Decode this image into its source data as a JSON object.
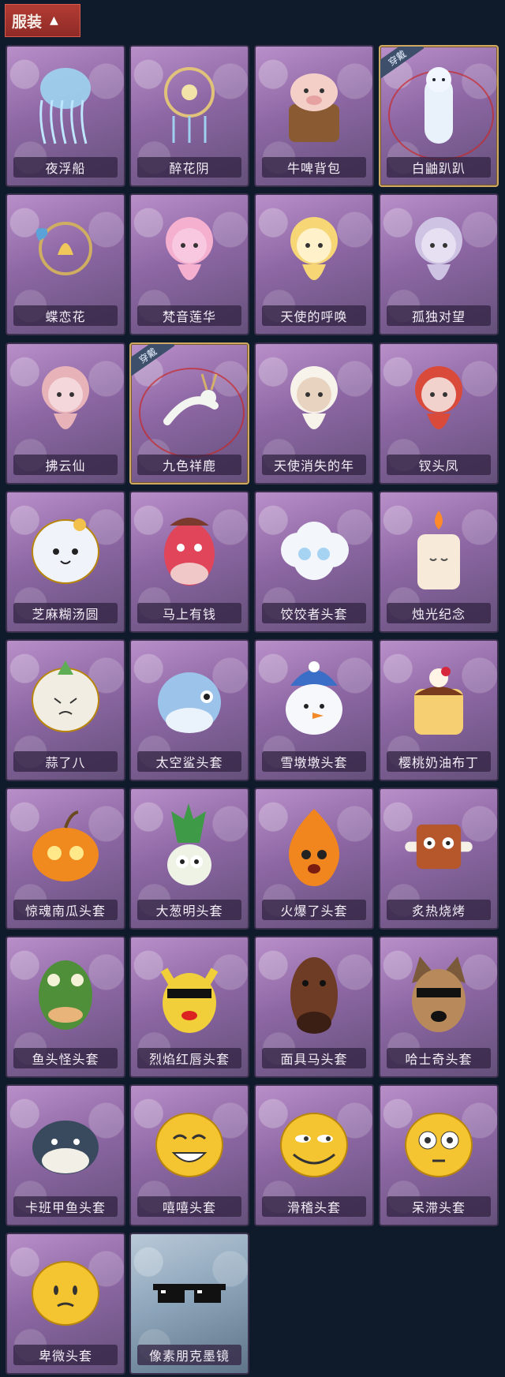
{
  "header": {
    "title": "服装",
    "arrow": "▲"
  },
  "worn_label": "穿戴",
  "items": [
    {
      "name": "夜浮船",
      "art": "jellyfish",
      "worn": false
    },
    {
      "name": "醉花阴",
      "art": "dreamcatcher",
      "worn": false
    },
    {
      "name": "牛啤背包",
      "art": "cow-barrel",
      "worn": false
    },
    {
      "name": "白鼬趴趴",
      "art": "ferret",
      "worn": true
    },
    {
      "name": "蝶恋花",
      "art": "butterfly-bell",
      "worn": false
    },
    {
      "name": "梵音莲华",
      "art": "pink-doll",
      "worn": false
    },
    {
      "name": "天使的呼唤",
      "art": "angel-doll",
      "worn": false
    },
    {
      "name": "孤独对望",
      "art": "silver-doll",
      "worn": false
    },
    {
      "name": "拂云仙",
      "art": "fox-doll",
      "worn": false
    },
    {
      "name": "九色祥鹿",
      "art": "deer",
      "worn": true
    },
    {
      "name": "天使消失的年",
      "art": "veil-doll",
      "worn": false
    },
    {
      "name": "钗头凤",
      "art": "opera-doll",
      "worn": false
    },
    {
      "name": "芝麻糊汤圆",
      "art": "dumpling",
      "worn": false
    },
    {
      "name": "马上有钱",
      "art": "red-horse",
      "worn": false
    },
    {
      "name": "饺饺者头套",
      "art": "cloud",
      "worn": false
    },
    {
      "name": "烛光纪念",
      "art": "candle",
      "worn": false
    },
    {
      "name": "蒜了八",
      "art": "garlic",
      "worn": false
    },
    {
      "name": "太空鲨头套",
      "art": "shark",
      "worn": false
    },
    {
      "name": "雪墩墩头套",
      "art": "snowman",
      "worn": false
    },
    {
      "name": "樱桃奶油布丁",
      "art": "pudding",
      "worn": false
    },
    {
      "name": "惊魂南瓜头套",
      "art": "pumpkin",
      "worn": false
    },
    {
      "name": "大葱明头套",
      "art": "scallion",
      "worn": false
    },
    {
      "name": "火爆了头套",
      "art": "fire",
      "worn": false
    },
    {
      "name": "炙热烧烤",
      "art": "grill-meat",
      "worn": false
    },
    {
      "name": "鱼头怪头套",
      "art": "fish-head",
      "worn": false
    },
    {
      "name": "烈焰红唇头套",
      "art": "pikachu",
      "worn": false
    },
    {
      "name": "面具马头套",
      "art": "horse-mask",
      "worn": false
    },
    {
      "name": "哈士奇头套",
      "art": "husky",
      "worn": false
    },
    {
      "name": "卡班甲鱼头套",
      "art": "turtle",
      "worn": false
    },
    {
      "name": "嘻嘻头套",
      "art": "grin-emoji",
      "worn": false
    },
    {
      "name": "滑稽头套",
      "art": "funny-emoji",
      "worn": false
    },
    {
      "name": "呆滞头套",
      "art": "stare-emoji",
      "worn": false
    },
    {
      "name": "卑微头套",
      "art": "humble-emoji",
      "worn": false
    },
    {
      "name": "像素朋克墨镜",
      "art": "pixel-glasses",
      "worn": false,
      "tint": "blue"
    }
  ]
}
